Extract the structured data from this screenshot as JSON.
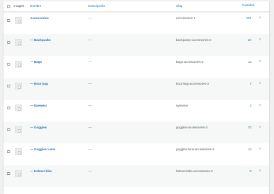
{
  "table": {
    "columns": {
      "image": "Imagen",
      "name": "Nombre",
      "description": "Descripción",
      "slug": "Slug",
      "count": "Cantidad"
    },
    "rows": [
      {
        "name": "Accessories",
        "description": "—",
        "slug": "accessories-2",
        "count": "201"
      },
      {
        "name": "— Backpacks",
        "description": "—",
        "slug": "backpacks-accessories-2",
        "count": "20"
      },
      {
        "name": "— Bags",
        "description": "—",
        "slug": "bags-accessories-2",
        "count": "13"
      },
      {
        "name": "— Boot bag",
        "description": "—",
        "slug": "boot-bag-accessories-2",
        "count": "7"
      },
      {
        "name": "— Eyewear",
        "description": "—",
        "slug": "eyewear",
        "count": "3"
      },
      {
        "name": "— Goggles",
        "description": "—",
        "slug": "goggles-accessories-2",
        "count": "70"
      },
      {
        "name": "— Goggles Lens",
        "description": "—",
        "slug": "goggles-lens-accessories-2",
        "count": "14"
      },
      {
        "name": "— Helmet bike",
        "description": "—",
        "slug": "helmet-bike-accessories-2",
        "count": "0"
      }
    ],
    "handle_glyph": "≡",
    "handle_icon": "drag-handle-icon",
    "thumb_icon": "placeholder-image-icon"
  },
  "colors": {
    "link": "#2271b1",
    "row_alt": "#f6f7f7",
    "page_bg": "#f0f0f1"
  }
}
